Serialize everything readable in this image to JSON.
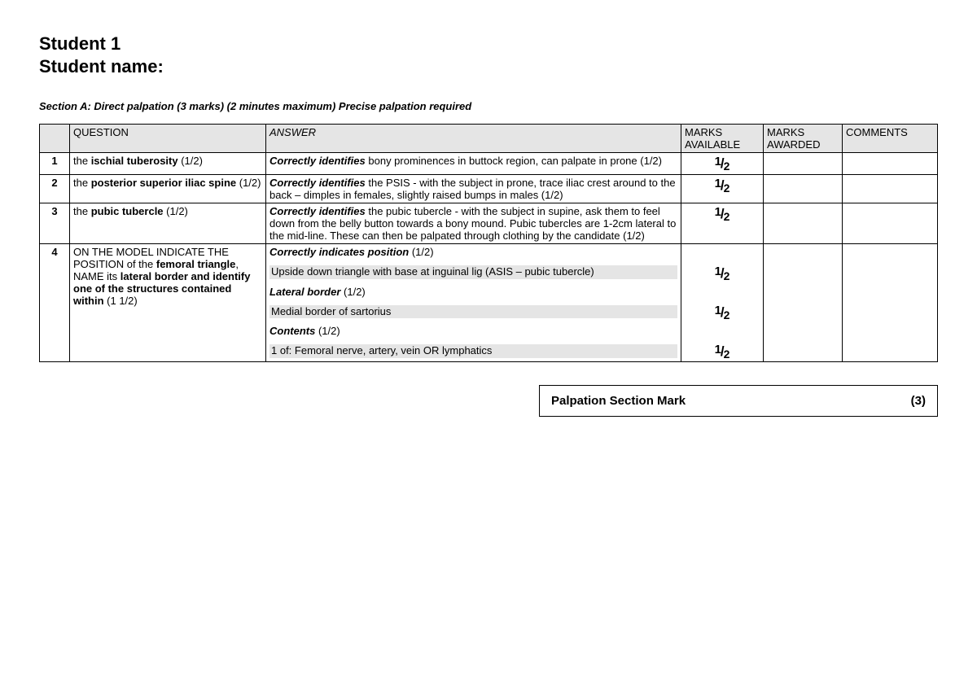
{
  "title_line1": "Student 1",
  "title_line2": "Student name:",
  "section_heading": "Section A: Direct palpation (3 marks) (2 minutes maximum) Precise palpation required",
  "headers": {
    "question": "QUESTION",
    "answer": "ANSWER",
    "marks_available": "MARKS AVAILABLE",
    "marks_awarded": "MARKS AWARDED",
    "comments": "COMMENTS"
  },
  "rows": [
    {
      "num": "1",
      "q_prefix": "the ",
      "q_bold": "ischial tuberosity",
      "q_suffix": " (1/2)",
      "a_bold": "Correctly identifies",
      "a_rest": " bony prominences in buttock region, can palpate in prone (1/2)",
      "mark": "½"
    },
    {
      "num": "2",
      "q_prefix": "the ",
      "q_bold": "posterior superior iliac spine",
      "q_suffix": " (1/2)",
      "a_bold": "Correctly identifies",
      "a_rest": " the PSIS - with the subject in prone, trace iliac crest around to the back – dimples in females, slightly raised bumps in males (1/2)",
      "mark": "½"
    },
    {
      "num": "3",
      "q_prefix": "the ",
      "q_bold": "pubic tubercle",
      "q_suffix": " (1/2)",
      "a_bold": "Correctly identifies",
      "a_rest": " the pubic tubercle - with the subject in supine, ask them to feel down from the belly button towards a bony mound. Pubic tubercles are 1-2cm lateral to the mid-line. These can then be palpated through clothing by the candidate (1/2)",
      "mark": "½"
    }
  ],
  "row4": {
    "num": "4",
    "q_p1": "ON THE MODEL INDICATE THE POSITION of the ",
    "q_b1": "femoral triangle",
    "q_p2": ", NAME its ",
    "q_b2": "lateral border and identify one of the structures contained within",
    "q_p3": " (1 1/2)",
    "a1_bold": "Correctly indicates position",
    "a1_rest": " (1/2)",
    "a_shade1": "Upside down triangle with base at inguinal lig (ASIS – pubic tubercle)",
    "a2_bold": "Lateral border",
    "a2_rest": " (1/2)",
    "a_shade2": "Medial border of sartorius",
    "a3_bold": "Contents",
    "a3_rest": " (1/2)",
    "a_shade3": "1 of: Femoral nerve, artery, vein OR lymphatics",
    "marks": [
      "½",
      "½",
      "½"
    ]
  },
  "footer": {
    "label": "Palpation Section Mark",
    "total": "(3)"
  }
}
